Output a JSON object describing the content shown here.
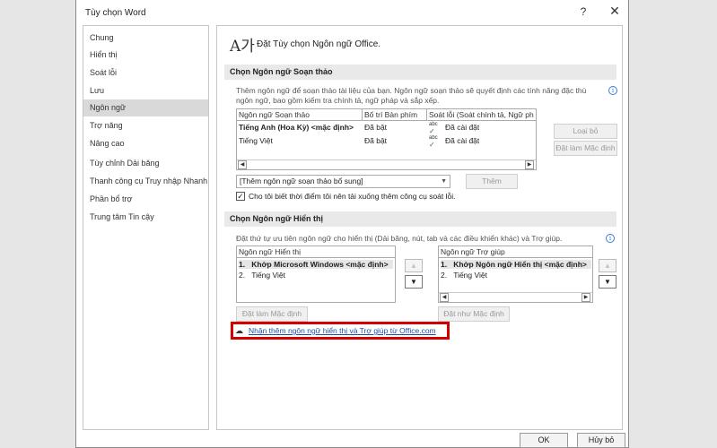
{
  "window": {
    "title": "Tùy chọn Word",
    "help_label": "?",
    "close_label": "✕"
  },
  "sidebar": {
    "items": [
      {
        "label": "Chung"
      },
      {
        "label": "Hiển thị"
      },
      {
        "label": "Soát lỗi"
      },
      {
        "label": "Lưu"
      },
      {
        "label": "Ngôn ngữ",
        "selected": true
      },
      {
        "label": "Trợ năng"
      },
      {
        "label": "Nâng cao"
      },
      {
        "label": "Tùy chỉnh Dải băng"
      },
      {
        "label": "Thanh công cụ Truy nhập Nhanh"
      },
      {
        "label": "Phần bổ trợ"
      },
      {
        "label": "Trung tâm Tin cậy"
      }
    ]
  },
  "main": {
    "icon_glyph": "A가",
    "heading": "Đặt Tùy chọn Ngôn ngữ Office.",
    "editing": {
      "section_title": "Chọn Ngôn ngữ Soạn thảo",
      "description": "Thêm ngôn ngữ để soạn thảo tài liệu của bạn. Ngôn ngữ soạn thảo sẽ quyết định các tính năng đặc thù ngôn ngữ, bao gồm kiểm tra chính tả, ngữ pháp và sắp xếp.",
      "info_glyph": "i",
      "columns": [
        "Ngôn ngữ Soạn thảo",
        "Bố trí Bàn phím",
        "Soát lỗi (Soát chính tả, Ngữ ph"
      ],
      "rows": [
        {
          "language": "Tiếng Anh (Hoa Kỳ) <mặc định>",
          "keyboard": "Đã bật",
          "proofing": "Đã cài đặt",
          "bold": true
        },
        {
          "language": "Tiếng Việt",
          "keyboard": "Đã bật",
          "proofing": "Đã cài đặt",
          "bold": false
        }
      ],
      "proofing_icon_text": "abc",
      "proofing_check": "✓",
      "scroll_left": "◀",
      "scroll_right": "▶",
      "remove_button": "Loại bỏ",
      "set_default_button": "Đặt làm Mặc định",
      "add_select_value": "[Thêm ngôn ngữ soạn thảo bổ sung]",
      "add_button": "Thêm",
      "notify_checkbox_checked": true,
      "notify_checkbox_mark": "✓",
      "notify_label": "Cho tôi biết thời điểm tôi nên tải xuống thêm công cụ soát lỗi."
    },
    "display": {
      "section_title": "Chọn Ngôn ngữ Hiển thị",
      "description": "Đặt thứ tự ưu tiên ngôn ngữ cho hiển thị (Dải băng, nút, tab và các điều khiển khác) và Trợ giúp.",
      "info_glyph": "i",
      "display_list": {
        "header": "Ngôn ngữ Hiển thị",
        "items": [
          {
            "index": "1.",
            "label": "Khớp Microsoft Windows <mặc định>",
            "bold": true
          },
          {
            "index": "2.",
            "label": "Tiếng Việt",
            "bold": false
          }
        ]
      },
      "help_list": {
        "header": "Ngôn ngữ Trợ giúp",
        "items": [
          {
            "index": "1.",
            "label": "Khớp Ngôn ngữ Hiển thị <mặc định>",
            "bold": true
          },
          {
            "index": "2.",
            "label": "Tiếng Việt",
            "bold": false
          }
        ]
      },
      "up_arrow": "▲",
      "down_arrow": "▼",
      "set_default_display_button": "Đặt làm Mặc định",
      "set_default_help_button": "Đặt như Mặc định",
      "link_icon": "☁",
      "link_text": "Nhận thêm ngôn ngữ hiển thị và Trợ giúp từ Office.com"
    }
  },
  "footer": {
    "ok_button": "OK",
    "cancel_button": "Hủy bỏ"
  },
  "colors": {
    "highlight_frame": "#d40000",
    "link": "#1f4e9e",
    "selected_nav": "#d9d9d9"
  }
}
